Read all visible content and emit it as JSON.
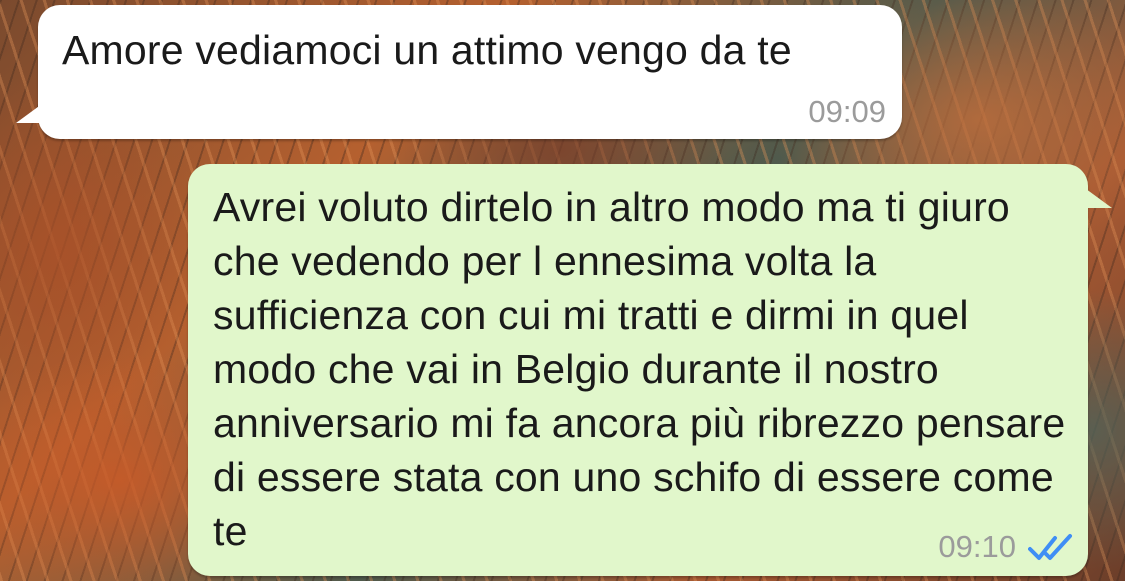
{
  "conversation": {
    "messages": [
      {
        "direction": "incoming",
        "text": "Amore vediamoci un attimo vengo da te",
        "time": "09:09"
      },
      {
        "direction": "outgoing",
        "text": "Avrei voluto dirtelo in altro modo ma ti giuro che vedendo per l ennesima volta la sufficienza con cui mi tratti e dirmi in quel modo che vai in Belgio durante il nostro anniversario mi fa ancora più ribrezzo pensare di essere stata con uno schifo di essere come te",
        "time": "09:10",
        "status_icon": "double-check-icon",
        "status_color": "#3f8ef5"
      }
    ]
  },
  "colors": {
    "incoming_bubble": "#ffffff",
    "outgoing_bubble": "#e1f7cb",
    "timestamp": "#9b9b9b"
  }
}
